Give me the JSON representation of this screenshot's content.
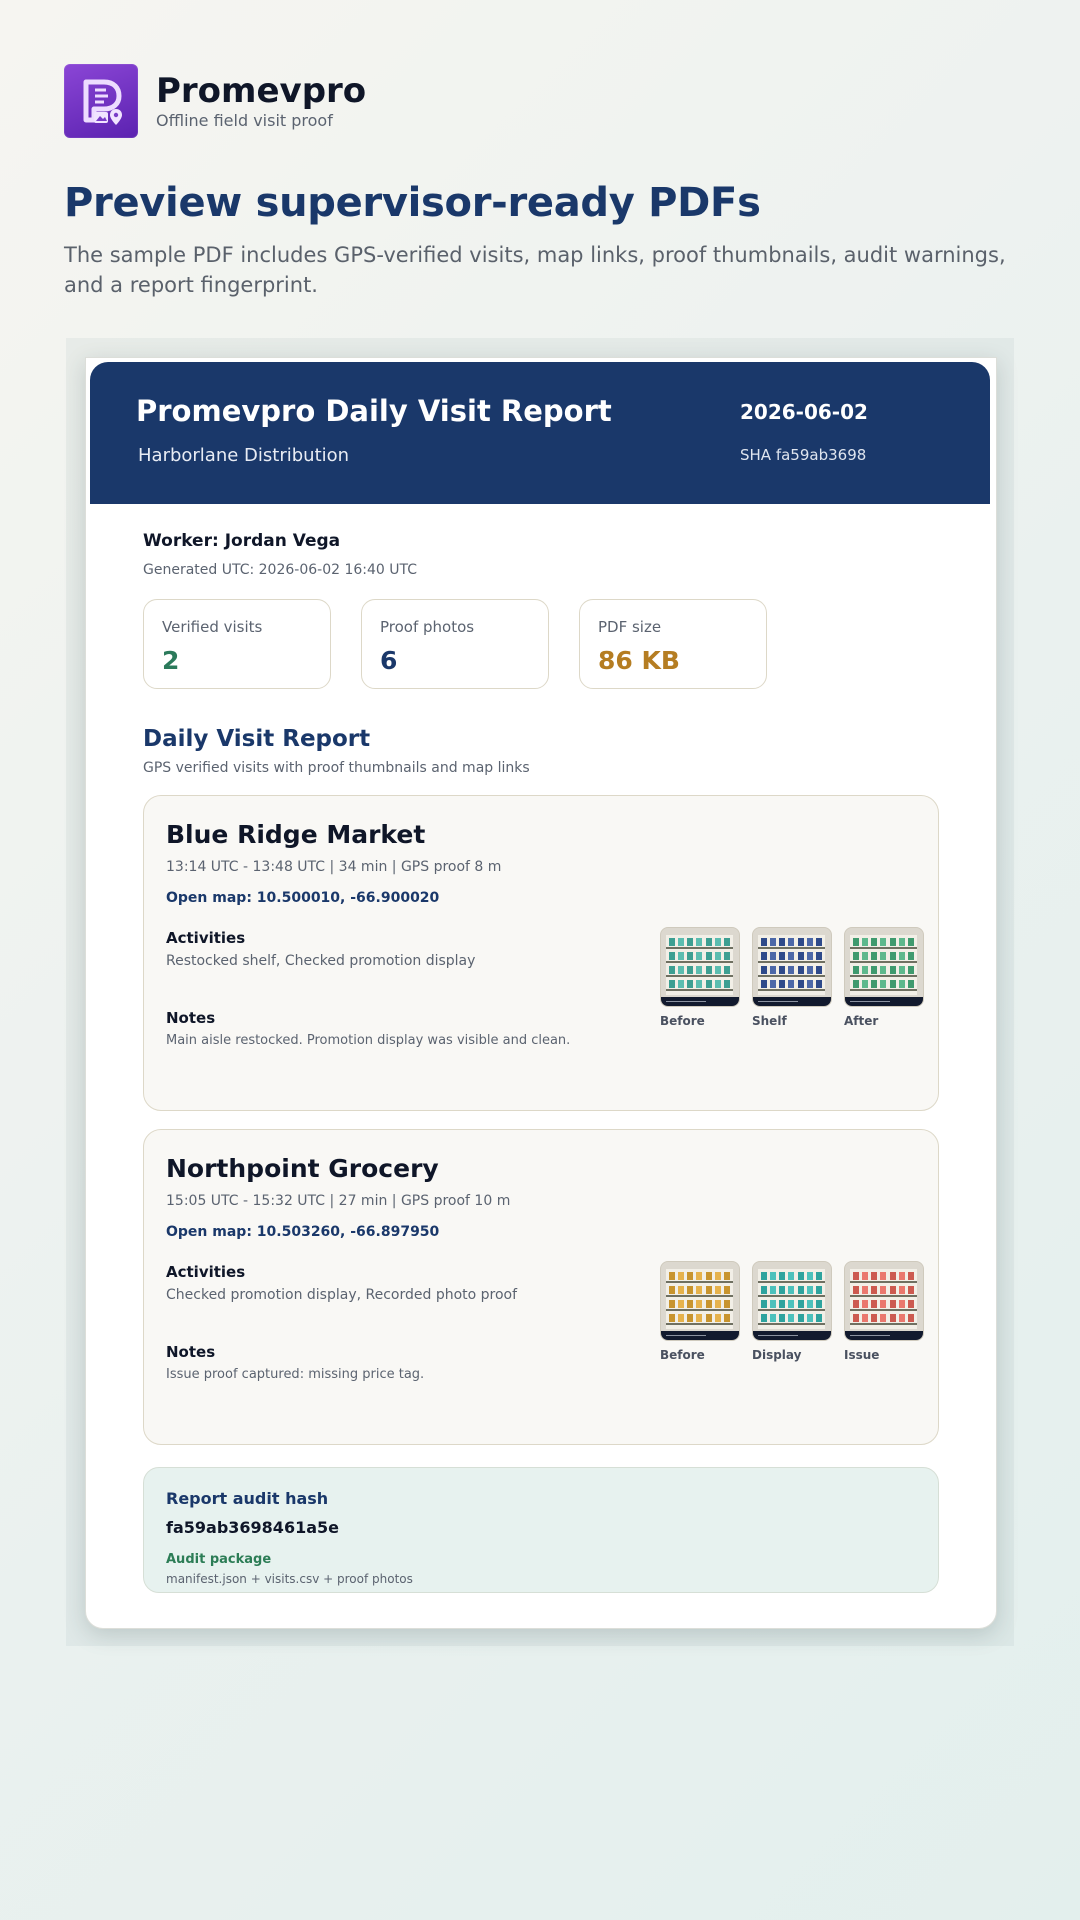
{
  "app": {
    "name": "Promevpro",
    "tagline": "Offline field visit proof"
  },
  "hero": {
    "title": "Preview supervisor-ready PDFs",
    "description": "The sample PDF includes GPS-verified visits, map links, proof thumbnails, audit warnings, and a report fingerprint."
  },
  "report": {
    "title": "Promevpro Daily Visit Report",
    "company": "Harborlane Distribution",
    "date": "2026-06-02",
    "sha": "SHA fa59ab3698",
    "worker": "Worker: Jordan Vega",
    "generated": "Generated UTC: 2026-06-02 16:40 UTC",
    "stats": [
      {
        "label": "Verified visits",
        "value": "2",
        "color": "#2b7a5b"
      },
      {
        "label": "Proof photos",
        "value": "6",
        "color": "#1a386a"
      },
      {
        "label": "PDF size",
        "value": "86 KB",
        "color": "#b57d22"
      }
    ],
    "section_title": "Daily Visit Report",
    "section_subtitle": "GPS verified visits with proof thumbnails and map links",
    "visits": [
      {
        "name": "Blue Ridge Market",
        "meta": "13:14 UTC - 13:48 UTC | 34 min | GPS proof 8 m",
        "map": "Open map: 10.500010, -66.900020",
        "activities_heading": "Activities",
        "activities": "Restocked shelf, Checked promotion display",
        "notes_heading": "Notes",
        "notes": "Main aisle restocked. Promotion display was visible and clean.",
        "photos": [
          {
            "label": "Before",
            "color": "#3d9f92"
          },
          {
            "label": "Shelf",
            "color": "#2e4a8a"
          },
          {
            "label": "After",
            "color": "#3f9a6e"
          }
        ]
      },
      {
        "name": "Northpoint Grocery",
        "meta": "15:05 UTC - 15:32 UTC | 27 min | GPS proof 10 m",
        "map": "Open map: 10.503260, -66.897950",
        "activities_heading": "Activities",
        "activities": "Checked promotion display, Recorded photo proof",
        "notes_heading": "Notes",
        "notes": "Issue proof captured: missing price tag.",
        "photos": [
          {
            "label": "Before",
            "color": "#c8942e"
          },
          {
            "label": "Display",
            "color": "#2ea39e"
          },
          {
            "label": "Issue",
            "color": "#cc5a50"
          }
        ]
      }
    ],
    "audit": {
      "title": "Report audit hash",
      "hash": "fa59ab3698461a5e",
      "package_title": "Audit package",
      "package_files": "manifest.json + visits.csv + proof photos"
    }
  }
}
